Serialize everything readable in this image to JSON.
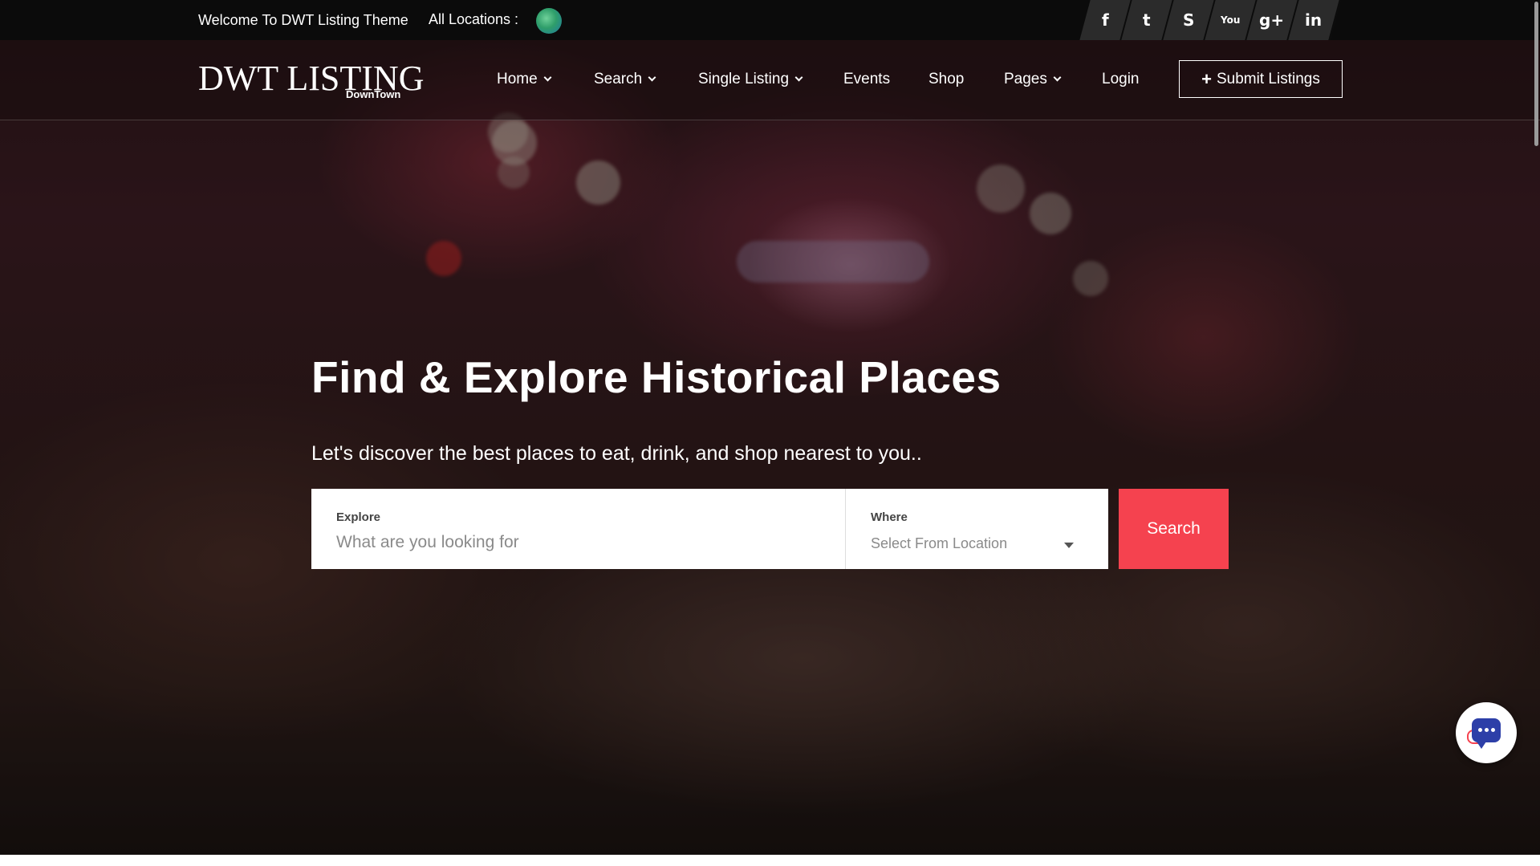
{
  "topbar": {
    "welcome": "Welcome To DWT Listing Theme",
    "locations_label": "All Locations :",
    "globe_icon": "globe-icon",
    "socials": [
      {
        "name": "facebook-icon",
        "glyph": "f"
      },
      {
        "name": "twitter-icon",
        "glyph": "t"
      },
      {
        "name": "skype-icon",
        "glyph": "S"
      },
      {
        "name": "youtube-icon",
        "glyph": "You"
      },
      {
        "name": "google-plus-icon",
        "glyph": "g+"
      },
      {
        "name": "linkedin-icon",
        "glyph": "in"
      }
    ]
  },
  "logo": {
    "main": "DWT LISTING",
    "sub": "DownTown"
  },
  "nav": {
    "home": "Home",
    "search": "Search",
    "single_listing": "Single Listing",
    "events": "Events",
    "shop": "Shop",
    "pages": "Pages",
    "login": "Login",
    "submit": "Submit Listings"
  },
  "hero": {
    "title": "Find & Explore Historical Places",
    "subtitle": "Let's discover the best places to eat, drink, and shop nearest to you..",
    "explore_label": "Explore",
    "explore_placeholder": "What are you looking for",
    "where_label": "Where",
    "where_value": "Select From Location",
    "search_button": "Search"
  },
  "colors": {
    "accent": "#f5424f",
    "topbar": "#0b0b0b"
  }
}
